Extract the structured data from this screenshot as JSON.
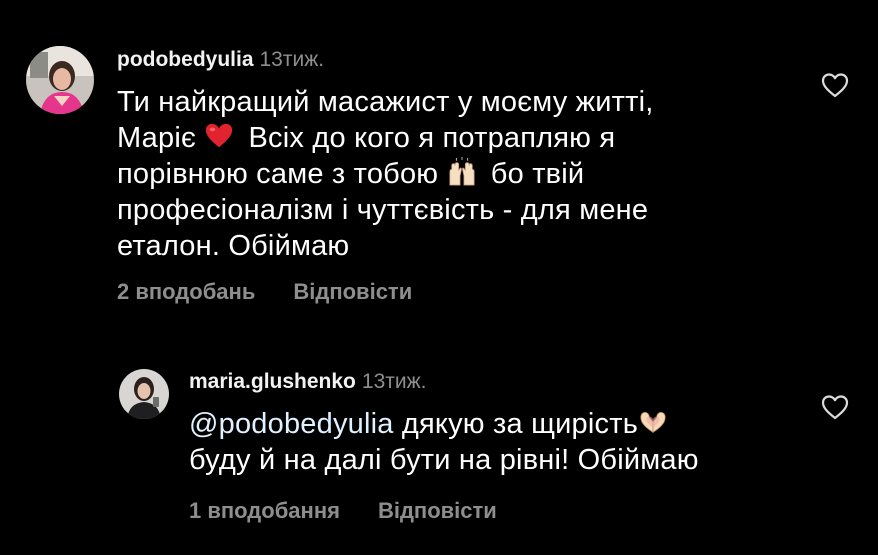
{
  "comments": [
    {
      "username": "podobedyulia",
      "time": "13тиж.",
      "text_lines": [
        "Ти найкращий масажист у моєму житті,",
        "Маріє",
        "Всіх до кого я потрапляю я",
        "порівнюю саме з тобою",
        "бо твій",
        "професіоналізм і чуттєвість - для мене",
        "еталон. Обіймаю"
      ],
      "emojis": [
        "red-heart",
        "raising-hands"
      ],
      "likes": "2 вподобань",
      "reply_label": "Відповісти",
      "like_icon": "heart-outline-icon"
    },
    {
      "username": "maria.glushenko",
      "time": "13тиж.",
      "mention": "@podobedyulia",
      "text_lines": [
        "дякую за щирість",
        "буду й на далі бути на  рівні! Обіймаю"
      ],
      "emojis": [
        "heart-hands"
      ],
      "likes": "1 вподобання",
      "reply_label": "Відповісти",
      "like_icon": "heart-outline-icon"
    }
  ]
}
